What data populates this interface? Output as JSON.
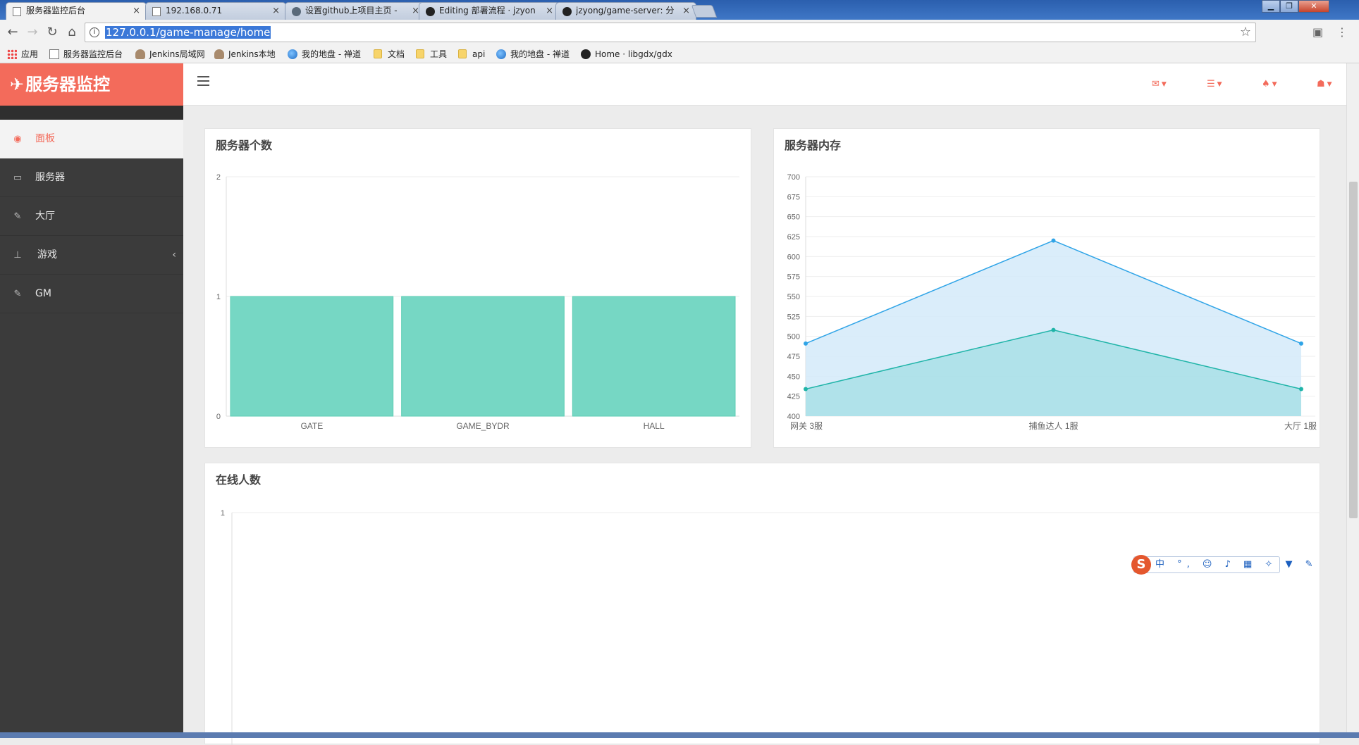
{
  "browser": {
    "tabs": [
      {
        "title": "服务器监控后台",
        "icon": "page-icon",
        "active": true
      },
      {
        "title": "192.168.0.71",
        "icon": "page-icon",
        "active": false
      },
      {
        "title": "设置github上项目主页 -",
        "icon": "github-edit-icon",
        "active": false
      },
      {
        "title": "Editing 部署流程 · jzyon",
        "icon": "github-icon",
        "active": false
      },
      {
        "title": "jzyong/game-server: 分",
        "icon": "github-icon",
        "active": false
      }
    ],
    "close_glyph": "×",
    "url": "127.0.0.1/game-manage/home",
    "info_glyph": "i",
    "bookmarks": [
      {
        "label": "应用",
        "icon": "apps"
      },
      {
        "label": "服务器监控后台",
        "icon": "page"
      },
      {
        "label": "Jenkins局域网",
        "icon": "person"
      },
      {
        "label": "Jenkins本地",
        "icon": "person"
      },
      {
        "label": "我的地盘 - 禅道",
        "icon": "globe"
      },
      {
        "label": "文档",
        "icon": "folder"
      },
      {
        "label": "工具",
        "icon": "folder"
      },
      {
        "label": "api",
        "icon": "folder"
      },
      {
        "label": "我的地盘 - 禅道",
        "icon": "globe"
      },
      {
        "label": "Home · libgdx/gdx",
        "icon": "gh"
      }
    ]
  },
  "app": {
    "brand": "服务器监控",
    "accent": "#f36b5b",
    "menu": [
      {
        "label": "面板",
        "icon": "dashboard-icon",
        "glyph": "◉",
        "active": true
      },
      {
        "label": "服务器",
        "icon": "desktop-icon",
        "glyph": "▭",
        "active": false
      },
      {
        "label": "大厅",
        "icon": "edit-icon",
        "glyph": "✎",
        "active": false
      },
      {
        "label": "游戏",
        "icon": "sitemap-icon",
        "glyph": "⊥",
        "active": false,
        "has_children": true
      },
      {
        "label": "GM",
        "icon": "edit-icon",
        "glyph": "✎",
        "active": false
      }
    ],
    "top_icons": [
      "envelope-icon",
      "tasks-icon",
      "bell-icon",
      "user-icon"
    ]
  },
  "panels": {
    "server_count_title": "服务器个数",
    "memory_title": "服务器内存",
    "online_title": "在线人数"
  },
  "chart_data": [
    {
      "type": "bar",
      "title": "服务器个数",
      "categories": [
        "GATE",
        "GAME_BYDR",
        "HALL"
      ],
      "values": [
        1,
        1,
        1
      ],
      "ylim": [
        0,
        2
      ],
      "yticks": [
        0,
        1,
        2
      ],
      "color": "#76d7c4",
      "grid": true
    },
    {
      "type": "area",
      "title": "服务器内存",
      "categories": [
        "网关 3服",
        "捕鱼达人 1服",
        "大厅 1服"
      ],
      "series": [
        {
          "values": [
            491,
            620,
            491
          ],
          "color": "#2fa4e7",
          "fill": "#d4eaf9"
        },
        {
          "values": [
            434,
            508,
            434
          ],
          "color": "#1fb4a8",
          "fill": "#a8dfe6"
        }
      ],
      "ylim": [
        400,
        700
      ],
      "yticks": [
        400,
        425,
        450,
        475,
        500,
        525,
        550,
        575,
        600,
        625,
        650,
        675,
        700
      ],
      "grid": true
    },
    {
      "type": "line",
      "title": "在线人数",
      "series": [],
      "yticks": [
        1
      ],
      "grid": true
    }
  ],
  "ime": {
    "logo": "S",
    "items": "中 °, ☺ ♪ ▦ ✧ ▼ ✎"
  }
}
